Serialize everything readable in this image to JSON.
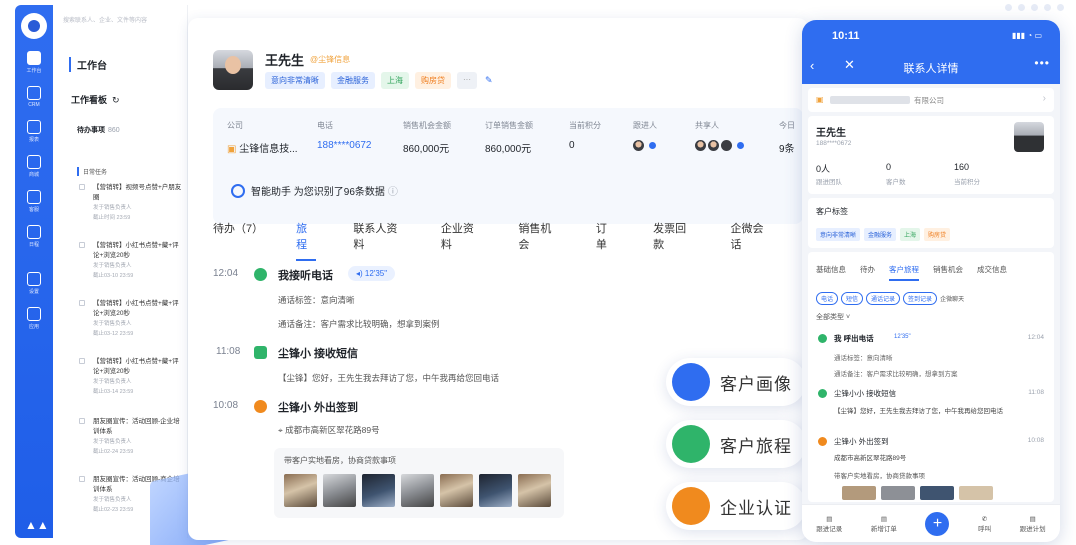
{
  "app": {
    "accent": "#2f6df0"
  },
  "rail": {
    "items": [
      {
        "label": "工作台",
        "icon": "workbench-icon"
      },
      {
        "label": "CRM",
        "icon": "user-icon"
      },
      {
        "label": "报表",
        "icon": "chart-icon"
      },
      {
        "label": "商城",
        "icon": "store-icon"
      },
      {
        "label": "客服",
        "icon": "chat-icon"
      },
      {
        "label": "日程",
        "icon": "clock-icon"
      },
      {
        "label": "设置",
        "icon": "gear-icon"
      },
      {
        "label": "应用",
        "icon": "apps-icon"
      }
    ]
  },
  "left": {
    "search_placeholder": "搜索联系人、企业、文件等内容",
    "workbench": "工作台",
    "board": "工作看板",
    "todo_label": "待办事项",
    "todo_count": "860",
    "today_label": "日常任务",
    "tasks": [
      {
        "title": "【营销转】视频号点赞+户朋友圈",
        "sub": "发于销售负责人",
        "date": "截止时间 23:59"
      },
      {
        "title": "【营销转】小红书点赞+藏+评论+浏览20秒",
        "sub": "发于销售负责人",
        "date": "截止03-10 23:59"
      },
      {
        "title": "【营销转】小红书点赞+藏+评论+浏览20秒",
        "sub": "发于销售负责人",
        "date": "截止03-12 23:59"
      },
      {
        "title": "【营销转】小红书点赞+藏+评论+浏览20秒",
        "sub": "发于销售负责人",
        "date": "截止03-14 23:59"
      },
      {
        "title": "朋友圈宣传：活动回顾-企业培训体系",
        "sub": "发于销售负责人",
        "date": "截止02-24 23:59"
      },
      {
        "title": "朋友圈宣传：活动回顾-商企培训体系",
        "sub": "发于销售负责人",
        "date": "截止02-23 23:59"
      }
    ]
  },
  "customer": {
    "name": "王先生",
    "company_tag": "@尘锋信息",
    "tags": [
      "意向非常清晰",
      "金融服务",
      "上海",
      "购房贷",
      "···"
    ],
    "info_headers": [
      "公司",
      "电话",
      "销售机会金额",
      "订单销售金额",
      "当前积分",
      "跟进人",
      "共享人",
      "今日"
    ],
    "company": "尘锋信息技...",
    "phone": "188****0672",
    "opp_amount": "860,000元",
    "order_amount": "860,000元",
    "points": "0",
    "today_val": "9条",
    "assistant": "智能助手 为您识别了96条数据",
    "tabs": [
      "待办（7）",
      "旅程",
      "联系人资料",
      "企业资料",
      "销售机会",
      "订单",
      "发票回款",
      "企微会话"
    ],
    "active_tab": 1
  },
  "timeline": [
    {
      "time": "12:04",
      "title": "我接听电话",
      "duration": "12'35\"",
      "l1": "通话标签：意向清晰",
      "l2": "通话备注：客户需求比较明确，想拿到案例"
    },
    {
      "time": "11:08",
      "title": "尘锋小 接收短信",
      "l1": "【尘锋】您好，王先生我去拜访了您，中午我再给您回电话"
    },
    {
      "time": "10:08",
      "title": "尘锋小 外出签到",
      "l1": "成都市高新区翠花路89号",
      "photo_title": "带客户实地看房，协商贷款事项"
    }
  ],
  "features": [
    {
      "label": "客户画像",
      "color": "#2f6df0"
    },
    {
      "label": "客户旅程",
      "color": "#2fb46a"
    },
    {
      "label": "企业认证",
      "color": "#f08a1e"
    }
  ],
  "phone": {
    "time": "10:11",
    "title": "联系人详情",
    "company": "有限公司",
    "name": "王先生",
    "phone": "188****0672",
    "stats": [
      {
        "value": "0人",
        "label": "跟进团队"
      },
      {
        "value": "0",
        "label": "客户数"
      },
      {
        "value": "160",
        "label": "当前积分"
      }
    ],
    "tag_title": "客户标签",
    "tags": [
      "意向非常清晰",
      "金融服务",
      "上海",
      "购房贷"
    ],
    "tabs": [
      "基础信息",
      "待办",
      "客户旅程",
      "销售机会",
      "成交信息"
    ],
    "active_tab": 2,
    "chips": [
      "电话",
      "短信",
      "通话记录",
      "签到记录",
      "企微聊天"
    ],
    "filter": "全部类型",
    "events": [
      {
        "title": "我 呼出电话",
        "duration": "12'35\"",
        "time": "12:04",
        "l1": "通话标签：意向清晰",
        "l2": "通话备注：客户需求比较明确，想拿到方案"
      },
      {
        "title": "尘锋小小 接收短信",
        "time": "11:08",
        "l1": "【尘锋】您好，王先生我去拜访了您，中午我再给您回电话"
      },
      {
        "title": "尘锋小 外出签到",
        "time": "10:08",
        "l1": "成都市高新区翠花路89号",
        "l2": "带客户实地看房，协商贷款事项"
      }
    ],
    "footer": [
      "跟进记录",
      "新增订单",
      "",
      "呼叫",
      "跟进计划"
    ]
  }
}
